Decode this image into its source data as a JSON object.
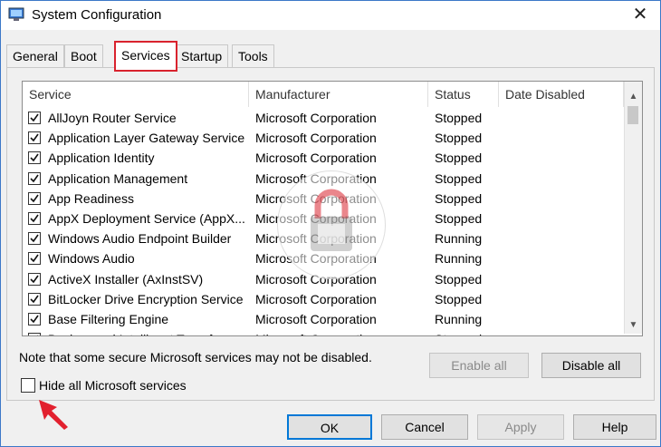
{
  "window": {
    "title": "System Configuration",
    "close_icon": "✕"
  },
  "tabs": [
    {
      "label": "General"
    },
    {
      "label": "Boot"
    },
    {
      "label": "Services",
      "active": true
    },
    {
      "label": "Startup"
    },
    {
      "label": "Tools"
    }
  ],
  "services": {
    "columns": [
      "Service",
      "Manufacturer",
      "Status",
      "Date Disabled"
    ],
    "rows": [
      {
        "name": "AllJoyn Router Service",
        "manufacturer": "Microsoft Corporation",
        "status": "Stopped",
        "checked": true
      },
      {
        "name": "Application Layer Gateway Service",
        "manufacturer": "Microsoft Corporation",
        "status": "Stopped",
        "checked": true
      },
      {
        "name": "Application Identity",
        "manufacturer": "Microsoft Corporation",
        "status": "Stopped",
        "checked": true
      },
      {
        "name": "Application Management",
        "manufacturer": "Microsoft Corporation",
        "status": "Stopped",
        "checked": true
      },
      {
        "name": "App Readiness",
        "manufacturer": "Microsoft Corporation",
        "status": "Stopped",
        "checked": true
      },
      {
        "name": "AppX Deployment Service (AppX...",
        "manufacturer": "Microsoft Corporation",
        "status": "Stopped",
        "checked": true
      },
      {
        "name": "Windows Audio Endpoint Builder",
        "manufacturer": "Microsoft Corporation",
        "status": "Running",
        "checked": true
      },
      {
        "name": "Windows Audio",
        "manufacturer": "Microsoft Corporation",
        "status": "Running",
        "checked": true
      },
      {
        "name": "ActiveX Installer (AxInstSV)",
        "manufacturer": "Microsoft Corporation",
        "status": "Stopped",
        "checked": true
      },
      {
        "name": "BitLocker Drive Encryption Service",
        "manufacturer": "Microsoft Corporation",
        "status": "Stopped",
        "checked": true
      },
      {
        "name": "Base Filtering Engine",
        "manufacturer": "Microsoft Corporation",
        "status": "Running",
        "checked": true
      },
      {
        "name": "Background Intelligent Transfer ...",
        "manufacturer": "Microsoft Corporation",
        "status": "Stopped",
        "checked": true
      }
    ]
  },
  "note": "Note that some secure Microsoft services may not be disabled.",
  "buttons": {
    "enable_all": "Enable all",
    "disable_all": "Disable all",
    "ok": "OK",
    "cancel": "Cancel",
    "apply": "Apply",
    "help": "Help"
  },
  "hide_ms_services": {
    "label": "Hide all Microsoft services",
    "checked": false
  },
  "colors": {
    "highlight": "#d9232e",
    "accent": "#0078d7"
  }
}
